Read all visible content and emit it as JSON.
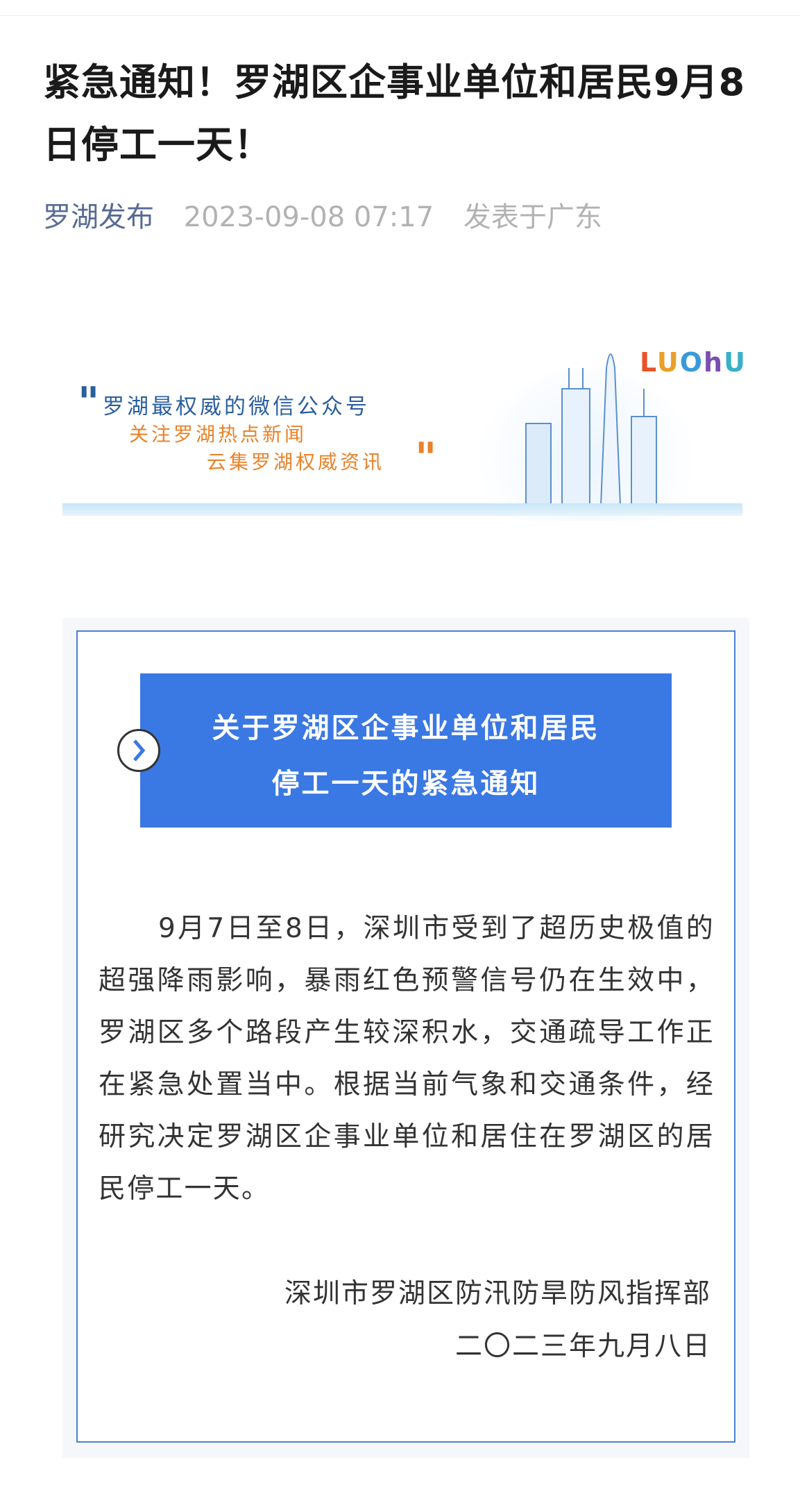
{
  "article": {
    "title": "紧急通知！罗湖区企事业单位和居民9月8日停工一天！",
    "account": "罗湖发布",
    "date": "2023-09-08 07:17",
    "location": "发表于广东"
  },
  "banner": {
    "line1": "罗湖最权威的微信公众号",
    "line2": "关注罗湖热点新闻",
    "line3": "云集罗湖权威资讯",
    "logo_text": "LUOhU",
    "colors": {
      "blue": "#2a5f9e",
      "orange": "#e8832a",
      "sky": "#c8e6f8"
    }
  },
  "notice": {
    "heading_line1": "关于罗湖区企事业单位和居民",
    "heading_line2": "停工一天的紧急通知",
    "chevron_icon": "chevron-right-icon",
    "body": "9月7日至8日，深圳市受到了超历史极值的超强降雨影响，暴雨红色预警信号仍在生效中，罗湖区多个路段产生较深积水，交通疏导工作正在紧急处置当中。根据当前气象和交通条件，经研究决定罗湖区企事业单位和居住在罗湖区的居民停工一天。",
    "signature_org": "深圳市罗湖区防汛防旱防风指挥部",
    "signature_date": "二〇二三年九月八日",
    "colors": {
      "accent": "#3a78e3",
      "border": "#4a80d6"
    }
  }
}
